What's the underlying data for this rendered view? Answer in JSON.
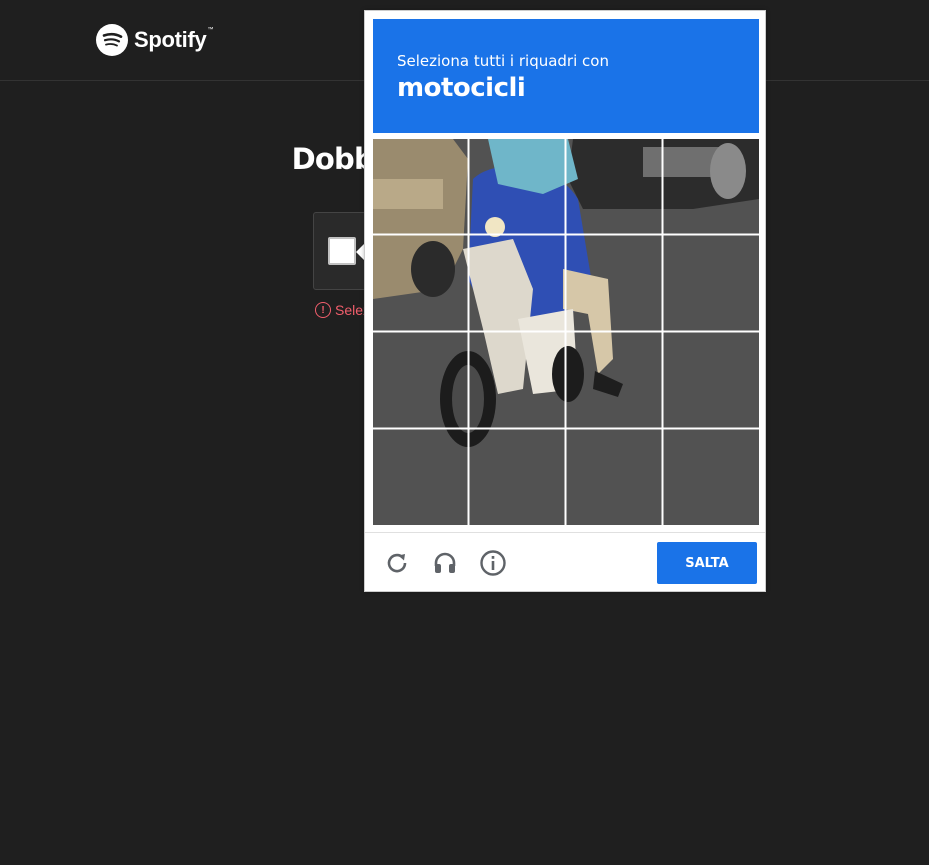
{
  "header": {
    "brand": "Spotify",
    "brand_tm": "™"
  },
  "page": {
    "title": "Dobbiamo assicur                                  ano",
    "error_text": "Selez"
  },
  "challenge": {
    "instruction": "Seleziona tutti i riquadri con",
    "target": "motocicli",
    "grid": {
      "rows": 4,
      "cols": 4,
      "selected_count": 0
    },
    "skip_label": "SALTA",
    "accent_color": "#1a73e8",
    "footer_icons": [
      "reload-icon",
      "headphones-icon",
      "info-icon"
    ]
  }
}
